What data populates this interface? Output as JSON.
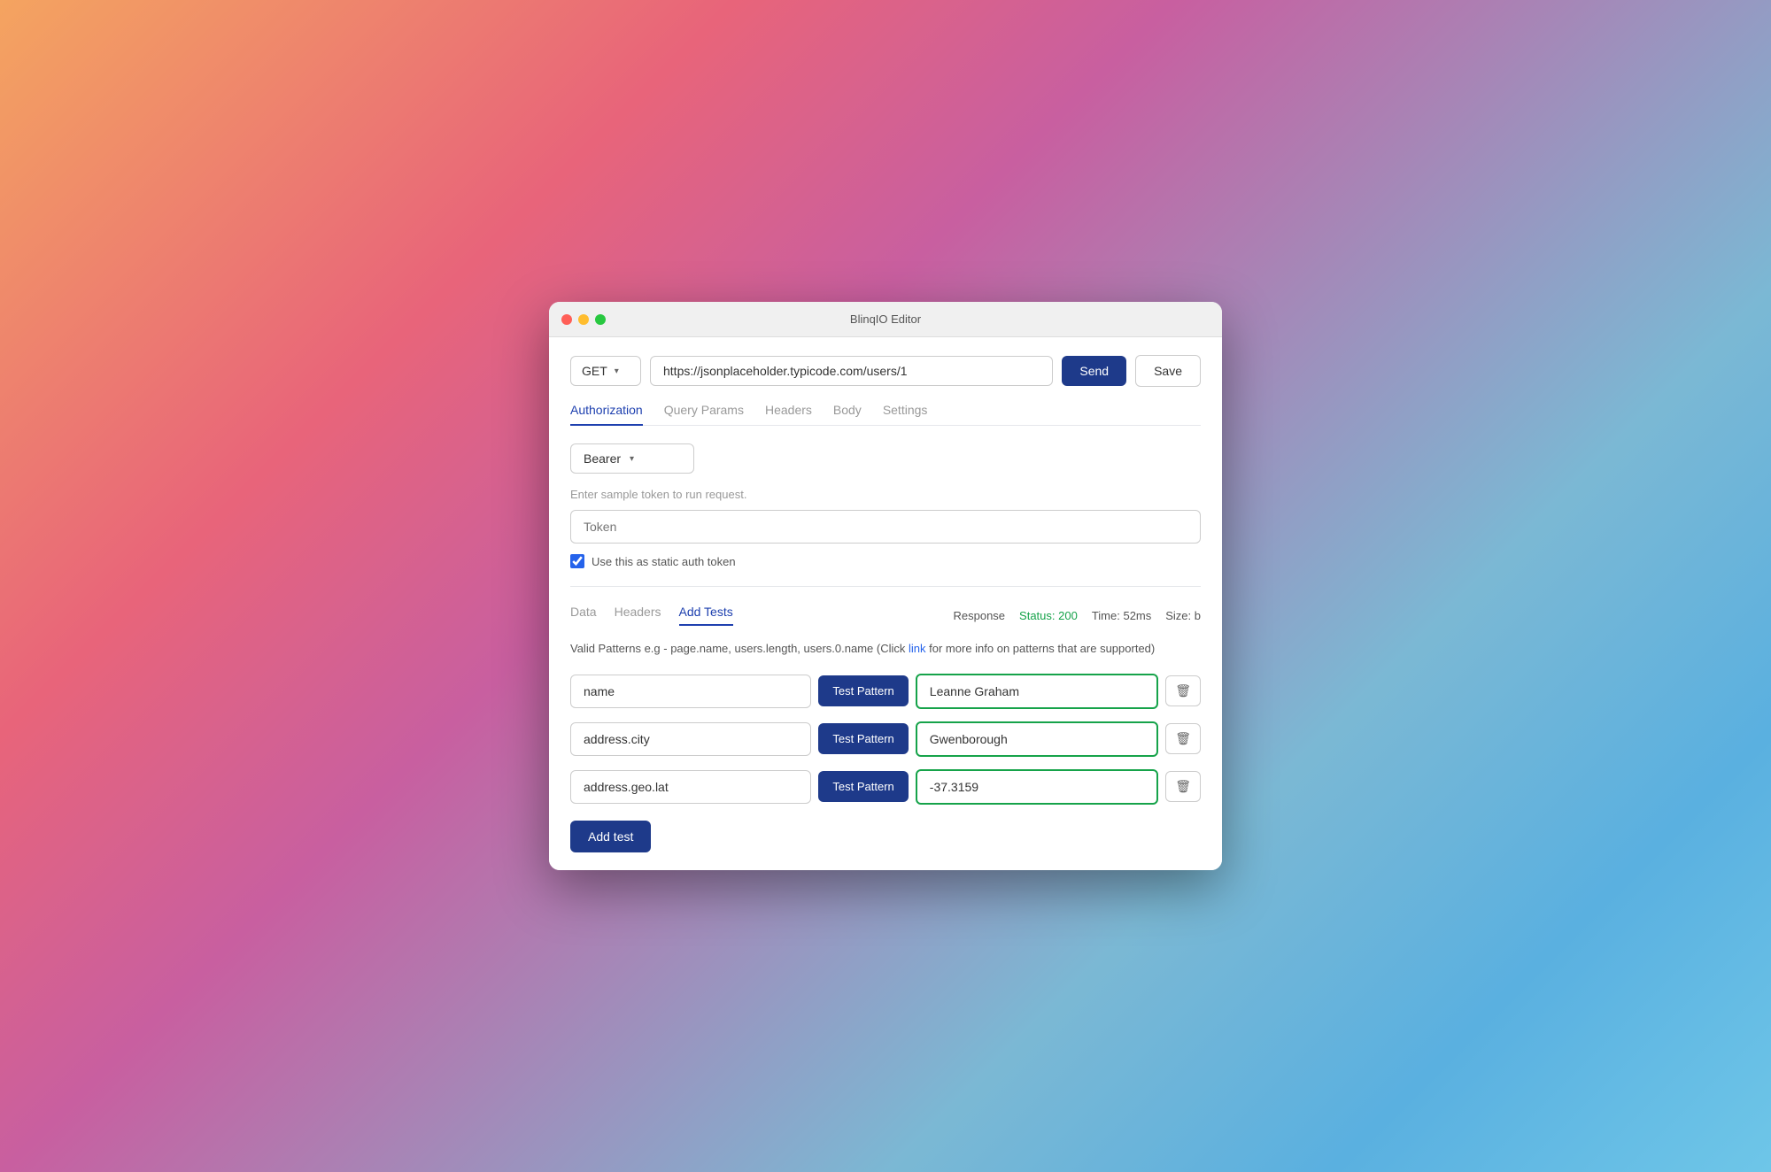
{
  "window": {
    "title": "BlinqIO Editor"
  },
  "traffic_lights": {
    "close_label": "close",
    "minimize_label": "minimize",
    "maximize_label": "maximize"
  },
  "url_bar": {
    "method": "GET",
    "url": "https://jsonplaceholder.typicode.com/users/1",
    "send_label": "Send",
    "save_label": "Save",
    "chevron": "▾"
  },
  "top_tabs": [
    {
      "label": "Authorization",
      "active": true
    },
    {
      "label": "Query Params",
      "active": false
    },
    {
      "label": "Headers",
      "active": false
    },
    {
      "label": "Body",
      "active": false
    },
    {
      "label": "Settings",
      "active": false
    }
  ],
  "auth": {
    "bearer_type": "Bearer",
    "chevron": "▾",
    "hint": "Enter sample token to run request.",
    "token_placeholder": "Token",
    "static_token_label": "Use this as static auth token",
    "static_token_checked": true
  },
  "response": {
    "label": "Response",
    "status_label": "Status: 200",
    "time_label": "Time: 52ms",
    "size_label": "Size: b"
  },
  "bottom_tabs": [
    {
      "label": "Data",
      "active": false
    },
    {
      "label": "Headers",
      "active": false
    },
    {
      "label": "Add Tests",
      "active": true
    }
  ],
  "patterns": {
    "info_text": "Valid Patterns e.g - page.name, users.length, users.0.name (Click ",
    "link_text": "link",
    "info_text2": " for more info on patterns that are supported)"
  },
  "test_rows": [
    {
      "pattern": "name",
      "test_button": "Test Pattern",
      "result": "Leanne Graham"
    },
    {
      "pattern": "address.city",
      "test_button": "Test Pattern",
      "result": "Gwenborough"
    },
    {
      "pattern": "address.geo.lat",
      "test_button": "Test Pattern",
      "result": "-37.3159"
    }
  ],
  "add_test_label": "Add test"
}
